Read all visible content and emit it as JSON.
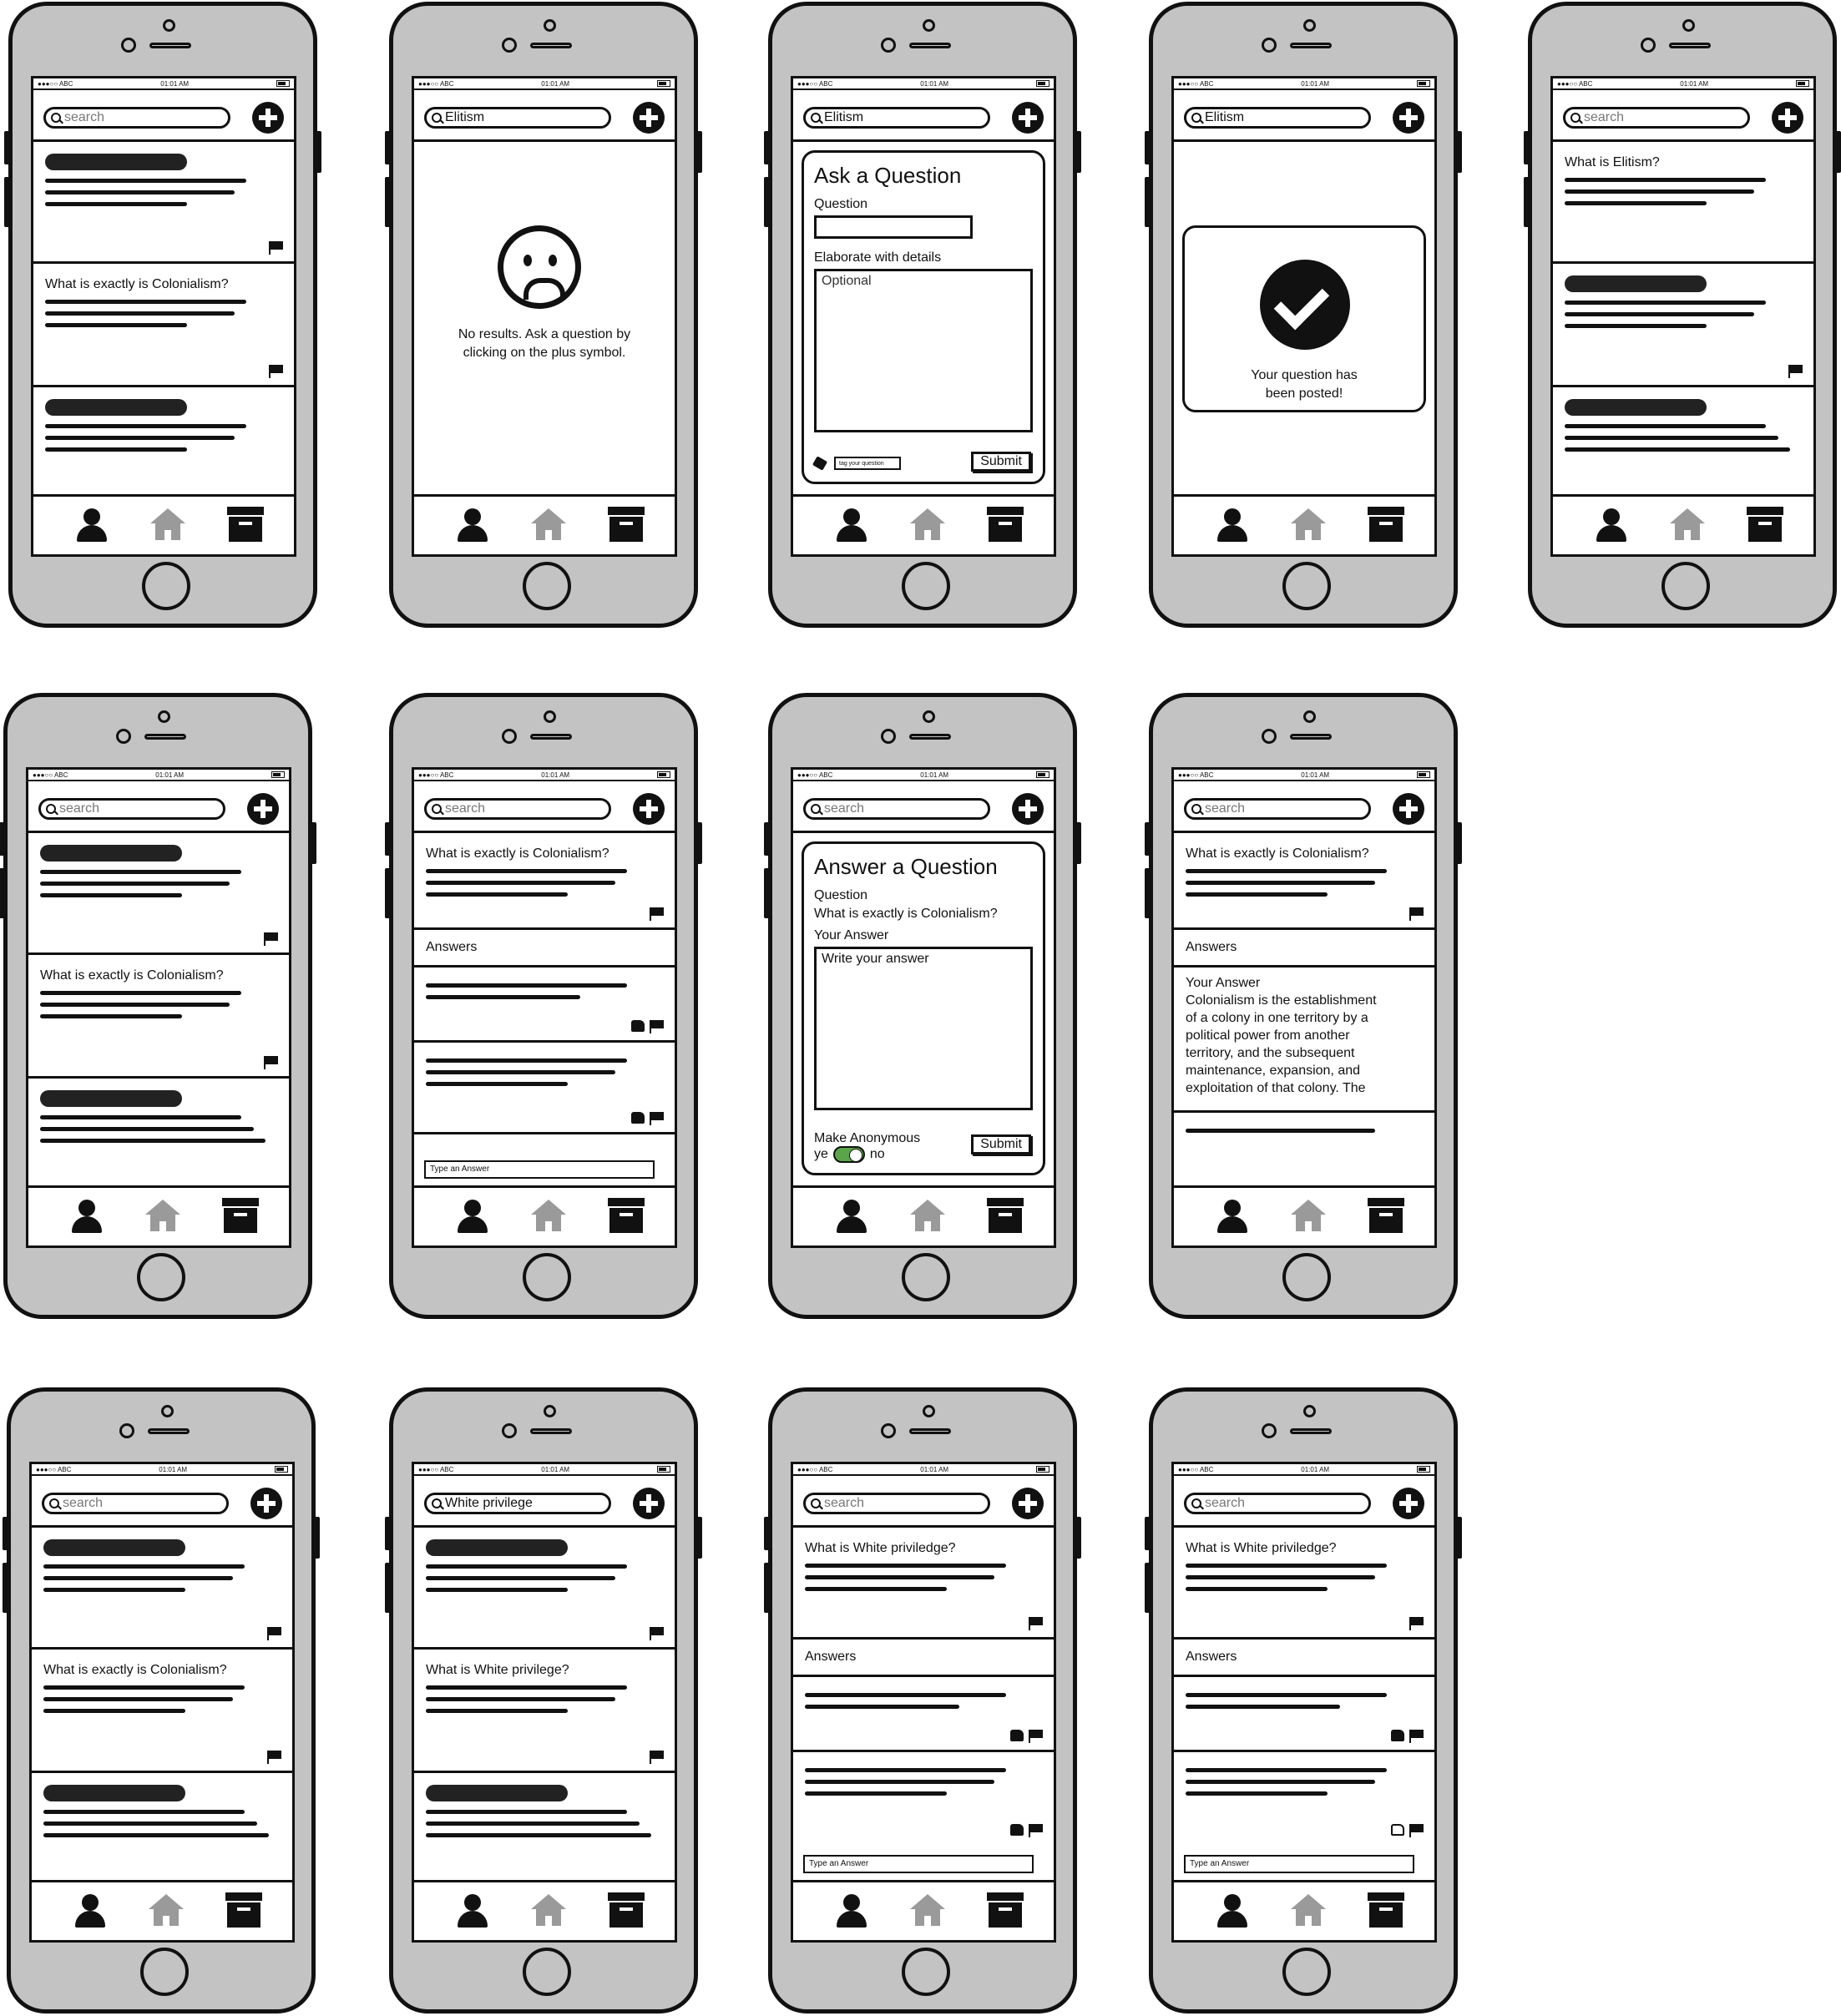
{
  "status": {
    "carrier": "●●●○○ ABC",
    "time": "01:01 AM"
  },
  "search": {
    "placeholder": "search"
  },
  "queries": {
    "elitism": "Elitism",
    "white_privilege": "White privilege"
  },
  "questions": {
    "colonialism": "What is exactly is Colonialism?",
    "elitism": "What is Elitism?",
    "white_privilege": "What is White privilege?",
    "white_priviledge": "What is White priviledge?"
  },
  "no_results": {
    "line1": "No results. Ask a question by",
    "line2": "clicking on the plus symbol."
  },
  "ask_form": {
    "title": "Ask a Question",
    "question_label": "Question",
    "details_label": "Elaborate with details",
    "details_placeholder": "Optional",
    "tag_placeholder": "tag your question",
    "submit": "Submit"
  },
  "posted": {
    "line1": "Your question has",
    "line2": "been posted!"
  },
  "answers": {
    "label": "Answers",
    "input_placeholder": "Type an Answer"
  },
  "answer_form": {
    "title": "Answer a Question",
    "question_label": "Question",
    "question_text": "What is exactly is Colonialism?",
    "answer_label": "Your Answer",
    "answer_placeholder": "Write your answer",
    "anonymous_label": "Make Anonymous",
    "yes": "ye",
    "no": "no",
    "submit": "Submit"
  },
  "your_answer": {
    "label": "Your Answer",
    "lines": [
      "Colonialism is the establishment",
      "of a colony in one territory by a",
      "political power from another",
      "territory, and the subsequent",
      "maintenance, expansion, and",
      "exploitation of that colony. The"
    ]
  }
}
